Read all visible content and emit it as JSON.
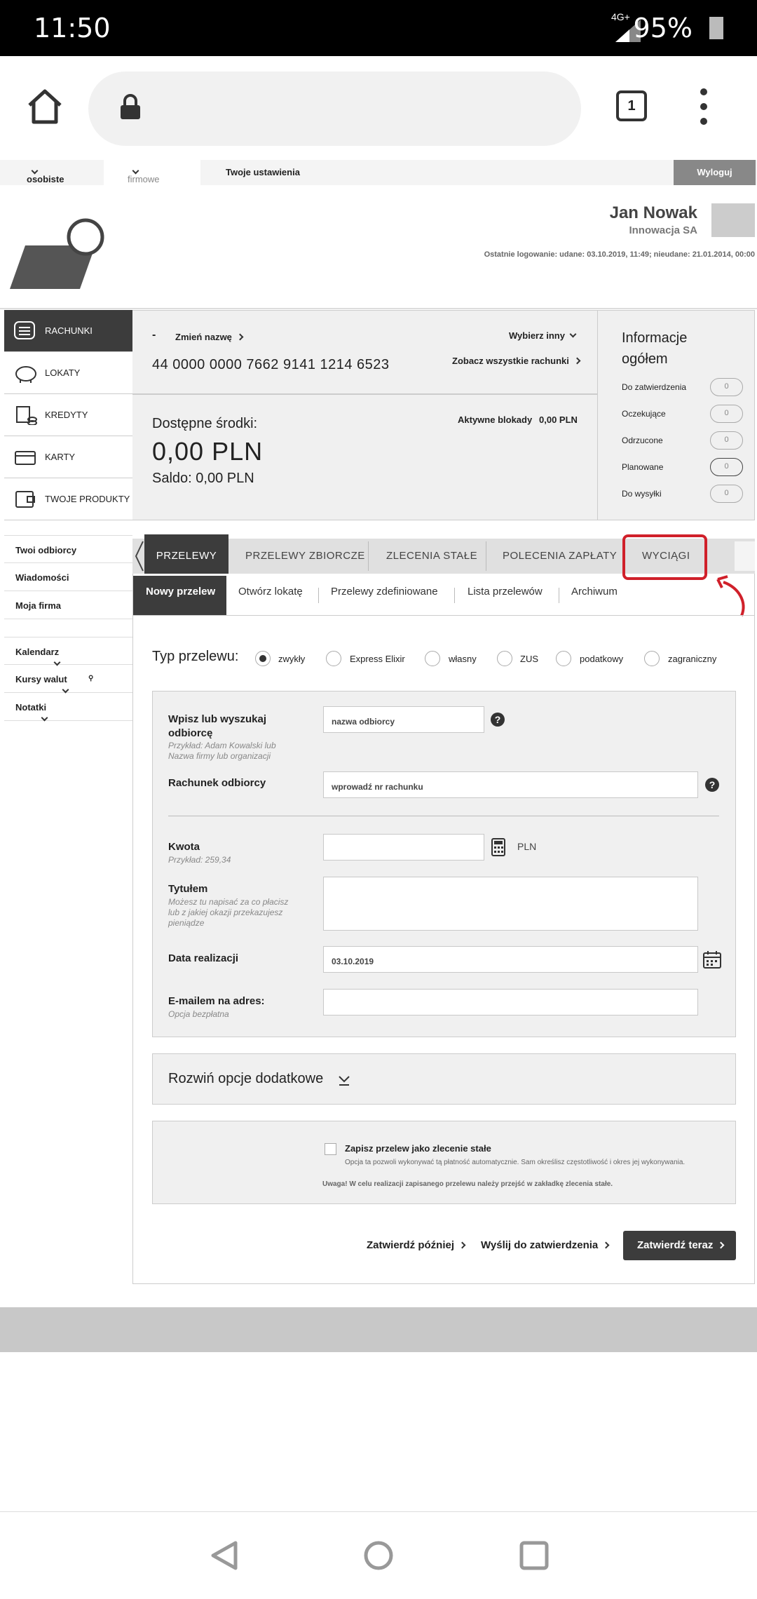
{
  "status": {
    "time": "11:50",
    "network": "4G+",
    "battery": "95%"
  },
  "browser": {
    "tab_count": "1"
  },
  "topnav": {
    "personal": "osobiste",
    "business": "firmowe",
    "settings": "Twoje ustawienia",
    "logout": "Wyloguj"
  },
  "user": {
    "name": "Jan Nowak",
    "company": "Innowacja SA",
    "last_login": "Ostatnie logowanie: udane: 03.10.2019, 11:49; nieudane: 21.01.2014, 00:00"
  },
  "sidebar": {
    "products": [
      {
        "label": "RACHUNKI",
        "icon": "list-icon"
      },
      {
        "label": "LOKATY",
        "icon": "piggy-bank-icon"
      },
      {
        "label": "KREDYTY",
        "icon": "coins-icon"
      },
      {
        "label": "KARTY",
        "icon": "card-icon"
      },
      {
        "label": "TWOJE PRODUKTY",
        "icon": "wallet-icon"
      }
    ],
    "links": [
      "Twoi odbiorcy",
      "Wiadomości",
      "Moja firma"
    ],
    "widgets": [
      "Kalendarz",
      "Kursy walut",
      "Notatki"
    ]
  },
  "account": {
    "dash": "-",
    "rename": "Zmień nazwę",
    "choose_other": "Wybierz inny",
    "number": "44 0000 0000 7662 9141 1214 6523",
    "see_all": "Zobacz wszystkie rachunki",
    "available_label": "Dostępne środki:",
    "available_value": "0,00 PLN",
    "balance": "Saldo: 0,00 PLN",
    "blocks_label": "Aktywne blokady",
    "blocks_value": "0,00 PLN"
  },
  "info": {
    "title": "Informacje ogółem",
    "rows": [
      {
        "label": "Do zatwierdzenia",
        "count": "0"
      },
      {
        "label": "Oczekujące",
        "count": "0"
      },
      {
        "label": "Odrzucone",
        "count": "0"
      },
      {
        "label": "Planowane",
        "count": "0"
      },
      {
        "label": "Do wysyłki",
        "count": "0"
      }
    ]
  },
  "tabs": [
    "PRZELEWY",
    "PRZELEWY ZBIORCZE",
    "ZLECENIA STAŁE",
    "POLECENIA ZAPŁATY",
    "WYCIĄGI"
  ],
  "subtabs": [
    "Nowy przelew",
    "Otwórz lokatę",
    "Przelewy zdefiniowane",
    "Lista przelewów",
    "Archiwum"
  ],
  "transfer_type": {
    "label": "Typ przelewu:",
    "options": [
      "zwykły",
      "Express Elixir",
      "własny",
      "ZUS",
      "podatkowy",
      "zagraniczny"
    ],
    "selected": "zwykły"
  },
  "form": {
    "recipient_label": "Wpisz lub wyszukaj odbiorcę",
    "recipient_hint": "Przykład: Adam Kowalski lub Nazwa firmy lub organizacji",
    "recipient_placeholder": "nazwa odbiorcy",
    "account_label": "Rachunek odbiorcy",
    "account_placeholder": "wprowadź nr rachunku",
    "amount_label": "Kwota",
    "amount_hint": "Przykład: 259,34",
    "currency": "PLN",
    "title_label": "Tytułem",
    "title_hint": "Możesz tu napisać za co płacisz lub z jakiej okazji przekazujesz pieniądze",
    "date_label": "Data realizacji",
    "date_value": "03.10.2019",
    "email_label": "E-mailem na adres:",
    "email_hint": "Opcja bezpłatna"
  },
  "extra_options": "Rozwiń opcje dodatkowe",
  "standing": {
    "checkbox_label": "Zapisz przelew jako zlecenie stałe",
    "desc": "Opcja ta pozwoli wykonywać tą płatność automatycznie. Sam określisz częstotliwość i okres jej wykonywania.",
    "warning": "Uwaga! W celu realizacji zapisanego przelewu należy przejść w zakładkę zlecenia stałe."
  },
  "actions": {
    "later": "Zatwierdź później",
    "send": "Wyślij do zatwierdzenia",
    "now": "Zatwierdź teraz"
  },
  "colors": {
    "highlight": "#d0202a",
    "dark": "#444444",
    "panel": "#f0f0f0"
  }
}
